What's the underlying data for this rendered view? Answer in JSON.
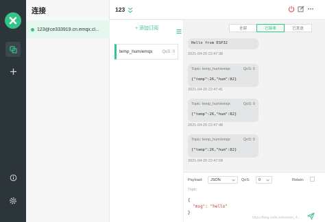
{
  "sidebar": {
    "logo_icon": "mqttx-logo-icon",
    "nav_icons": [
      "connections-icon",
      "add-icon"
    ],
    "bottom_icons": [
      "about-icon",
      "settings-icon"
    ]
  },
  "connections": {
    "title": "连接",
    "items": [
      {
        "label": "123@ce333919.cn.emqx.cl..."
      }
    ]
  },
  "header": {
    "name": "123",
    "accent": "#34c388",
    "disconnect_color": "#e74c3c"
  },
  "subscriptions": {
    "add_label": "+ 添加订阅",
    "items": [
      {
        "topic": "temp_hum/emqx",
        "qos": "QoS: 0"
      }
    ]
  },
  "message_tabs": [
    "全部",
    "已接收",
    "已发送"
  ],
  "messages": [
    {
      "topic": "",
      "qos": "",
      "payload": "Hello from ESP32",
      "time": "2021-04-20 22:47:38"
    },
    {
      "topic": "Topic: temp_hum/emqx",
      "qos": "QoS: 0",
      "payload": "{\"temp\":26,\"hum\":82}",
      "time": "2021-04-20 22:47:41"
    },
    {
      "topic": "Topic: temp_hum/emqx",
      "qos": "QoS: 0",
      "payload": "{\"temp\":26,\"hum\":82}",
      "time": "2021-04-20 22:47:48"
    },
    {
      "topic": "Topic: temp_hum/emqx",
      "qos": "QoS: 0",
      "payload": "{\"temp\":26,\"hum\":82}",
      "time": "2021-04-20 22:47:58"
    }
  ],
  "composer": {
    "payload_label": "Payload:",
    "payload_format": "JSON",
    "qos_label": "QoS:",
    "qos_value": "0",
    "retain_label": "Retain:",
    "topic_placeholder": "Topic",
    "code": {
      "open": "{",
      "key": "\"msg\"",
      "sep": ": ",
      "value": "\"hello\"",
      "close": "}"
    },
    "watermark": "https://blog.csdn.net/weixin_4..."
  }
}
